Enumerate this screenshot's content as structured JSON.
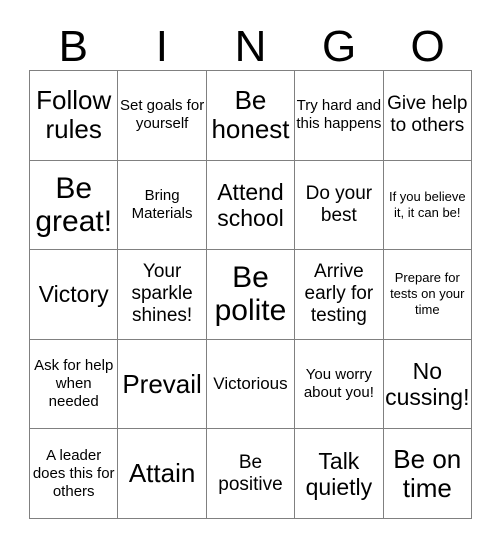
{
  "header": {
    "letters": [
      "B",
      "I",
      "N",
      "G",
      "O"
    ]
  },
  "grid": {
    "rows": [
      [
        {
          "text": "Follow rules",
          "size": "fs-lg"
        },
        {
          "text": "Set goals for yourself",
          "size": "fs-xxs"
        },
        {
          "text": "Be honest",
          "size": "fs-lg"
        },
        {
          "text": "Try hard and this happens",
          "size": "fs-xxs"
        },
        {
          "text": "Give help to others",
          "size": "fs-sm"
        }
      ],
      [
        {
          "text": "Be great!",
          "size": "fs-xl"
        },
        {
          "text": "Bring Materials",
          "size": "fs-xxs"
        },
        {
          "text": "Attend school",
          "size": "fs-md"
        },
        {
          "text": "Do your best",
          "size": "fs-sm"
        },
        {
          "text": "If you believe it, it can be!",
          "size": "fs-t"
        }
      ],
      [
        {
          "text": "Victory",
          "size": "fs-md"
        },
        {
          "text": "Your sparkle shines!",
          "size": "fs-sm"
        },
        {
          "text": "Be polite",
          "size": "fs-xl"
        },
        {
          "text": "Arrive early for testing",
          "size": "fs-sm"
        },
        {
          "text": "Prepare for tests on your time",
          "size": "fs-t"
        }
      ],
      [
        {
          "text": "Ask for help when needed",
          "size": "fs-xxs"
        },
        {
          "text": "Prevail",
          "size": "fs-lg"
        },
        {
          "text": "Victorious",
          "size": "fs-xs"
        },
        {
          "text": "You worry about you!",
          "size": "fs-xxs"
        },
        {
          "text": "No cussing!",
          "size": "fs-md"
        }
      ],
      [
        {
          "text": "A leader does this for others",
          "size": "fs-xxs"
        },
        {
          "text": "Attain",
          "size": "fs-lg"
        },
        {
          "text": "Be positive",
          "size": "fs-sm"
        },
        {
          "text": "Talk quietly",
          "size": "fs-md"
        },
        {
          "text": "Be on time",
          "size": "fs-lg"
        }
      ]
    ]
  }
}
